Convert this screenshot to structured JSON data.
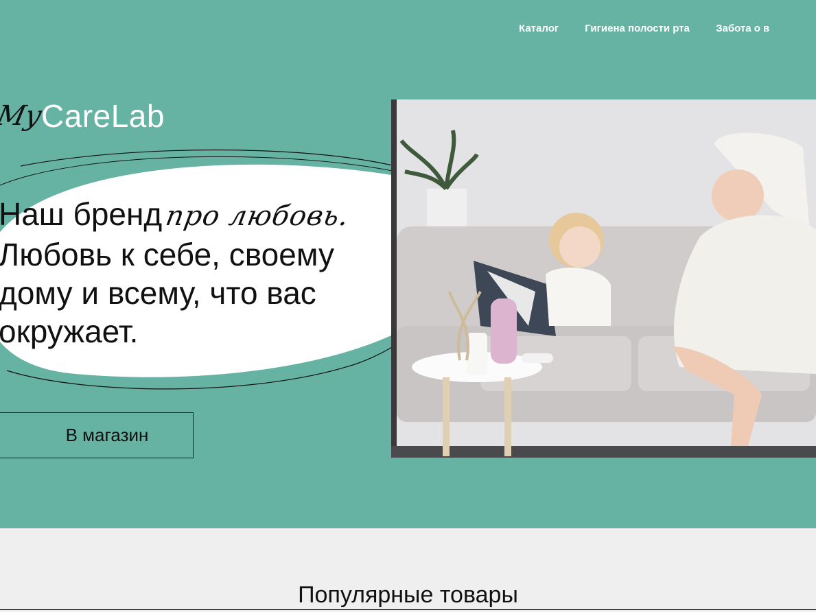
{
  "nav": {
    "items": [
      "Каталог",
      "Гигиена полости рта",
      "Забота о в"
    ]
  },
  "logo": {
    "script": "My",
    "word": "CareLab"
  },
  "hero": {
    "line1_plain": "Наш бренд",
    "line1_script": "про любовь.",
    "line2": "Любовь к себе, своему",
    "line3": "дому и всему, что вас",
    "line4": "окружает.",
    "cta_label": "В магазин"
  },
  "popular": {
    "title": "Популярные товары"
  },
  "colors": {
    "hero_bg": "#66b3a4",
    "page_bg": "#efefef",
    "text": "#111111"
  }
}
